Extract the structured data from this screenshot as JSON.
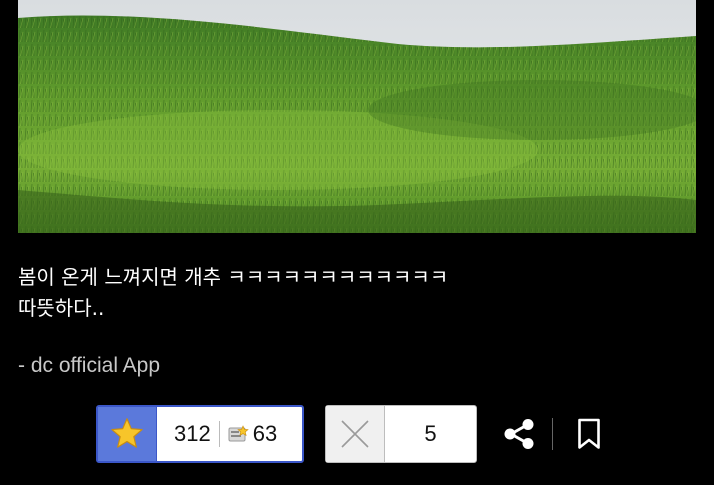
{
  "post": {
    "text_line1": "봄이 온게 느껴지면 개추 ㅋㅋㅋㅋㅋㅋㅋㅋㅋㅋㅋㅋ",
    "text_line2": "따뜻하다..",
    "signature": "- dc official App"
  },
  "recommend": {
    "up_count": "312",
    "fix_count": "63",
    "down_count": "5"
  },
  "icons": {
    "recommend": "star-icon",
    "fixed_recommend": "fixed-badge-icon",
    "not_recommend": "x-icon",
    "share": "share-icon",
    "bookmark": "bookmark-icon"
  },
  "colors": {
    "recommend_accent": "#5b79db",
    "star": "#f7c52a",
    "background": "#000000"
  }
}
